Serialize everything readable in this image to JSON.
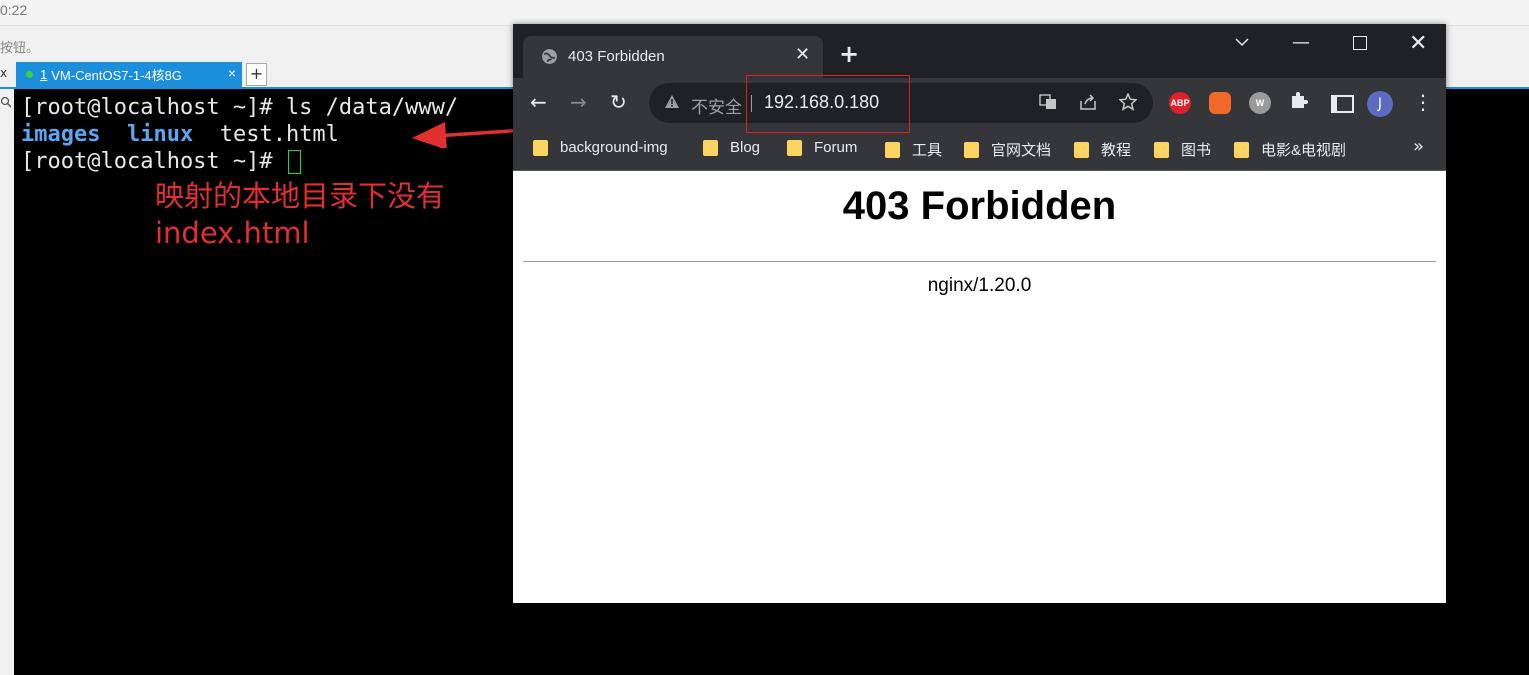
{
  "host": {
    "time_fragment": "0:22",
    "hint_text": "按钮。",
    "terminal_tab": {
      "number": "1",
      "label": "VM-CentOS7-1-4核8G",
      "close": "×"
    },
    "left_tab_close": "x",
    "add_tab": "+",
    "gutter_icon": "search-icon"
  },
  "terminal": {
    "line1": "[root@localhost ~]# ls /data/www/",
    "line2_dirs": [
      "images",
      "linux"
    ],
    "line2_file": "test.html",
    "line3": "[root@localhost ~]# "
  },
  "annotation": {
    "line1": "映射的本地目录下没有",
    "line2": "index.html",
    "color": "#e03030"
  },
  "browser": {
    "tab_title": "403 Forbidden",
    "tab_close": "✕",
    "new_tab": "+",
    "window_controls": {
      "dropdown": "chevron-down-icon",
      "minimize": "—",
      "close": "✕"
    },
    "nav": {
      "back": "←",
      "forward": "→",
      "reload": "↻"
    },
    "insecure_label": "不安全",
    "url": "192.168.0.180",
    "extensions": {
      "abp": "ABP",
      "w": "W"
    },
    "avatar_letter": "J",
    "menu": "⋮",
    "bookmarks": [
      "background-img",
      "Blog",
      "Forum",
      "工具",
      "官网文档",
      "教程",
      "图书",
      "电影&电视剧"
    ],
    "bookmarks_more": "»",
    "page": {
      "heading": "403 Forbidden",
      "server": "nginx/1.20.0"
    }
  }
}
